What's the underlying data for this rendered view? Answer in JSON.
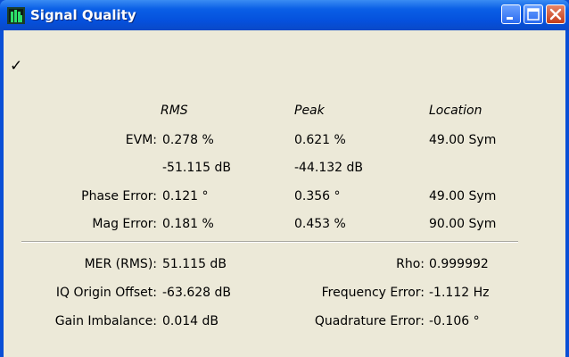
{
  "window": {
    "title": "Signal Quality",
    "status_check": "✓",
    "colors": {
      "titlebar": "#0a5fe6",
      "client_bg": "#ece9d8",
      "close_button": "#c53d1a"
    }
  },
  "table": {
    "headers": {
      "rms": "RMS",
      "peak": "Peak",
      "location": "Location"
    },
    "evm": {
      "label": "EVM:",
      "rms_pct": "0.278 %",
      "peak_pct": "0.621 %",
      "location": "49.00 Sym",
      "rms_db": "-51.115 dB",
      "peak_db": "-44.132 dB"
    },
    "phase_error": {
      "label": "Phase Error:",
      "rms": "0.121 °",
      "peak": "0.356 °",
      "location": "49.00 Sym"
    },
    "mag_error": {
      "label": "Mag Error:",
      "rms": "0.181 %",
      "peak": "0.453 %",
      "location": "90.00 Sym"
    }
  },
  "summary": {
    "mer": {
      "label": "MER (RMS):",
      "value": "51.115 dB"
    },
    "rho": {
      "label": "Rho:",
      "value": "0.999992"
    },
    "iq_offset": {
      "label": "IQ Origin Offset:",
      "value": "-63.628 dB"
    },
    "freq_error": {
      "label": "Frequency Error:",
      "value": "-1.112 Hz"
    },
    "gain_imbalance": {
      "label": "Gain Imbalance:",
      "value": "0.014 dB"
    },
    "quad_error": {
      "label": "Quadrature Error:",
      "value": "-0.106 °"
    }
  }
}
